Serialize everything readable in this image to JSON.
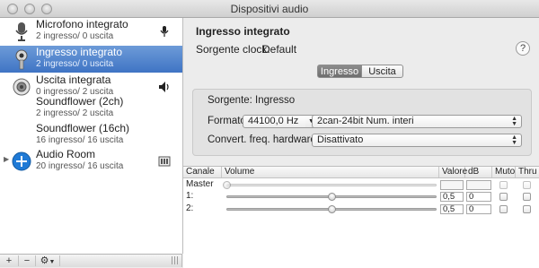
{
  "window": {
    "title": "Dispositivi audio"
  },
  "devices": [
    {
      "name": "Microfono integrato",
      "sub": "2 ingresso/ 0 uscita",
      "icon": "microphone-icon",
      "badge": "microphone-icon",
      "selected": false
    },
    {
      "name": "Ingresso integrato",
      "sub": "2 ingresso/ 0 uscita",
      "icon": "input-jack-icon",
      "badge": "",
      "selected": true
    },
    {
      "name": "Uscita integrata",
      "sub": "0 ingresso/ 2 uscita",
      "icon": "speaker-icon",
      "badge": "volume-icon",
      "selected": false
    },
    {
      "name": "Soundflower (2ch)",
      "sub": "2 ingresso/ 2 uscita",
      "icon": "",
      "badge": "",
      "selected": false
    },
    {
      "name": "Soundflower (16ch)",
      "sub": "16 ingresso/ 16 uscita",
      "icon": "",
      "badge": "",
      "selected": false
    },
    {
      "name": "Audio Room",
      "sub": "20 ingresso/ 16 uscita",
      "icon": "add-device-icon",
      "badge": "aggregate-icon",
      "selected": false
    }
  ],
  "toolbar": {
    "add": "+",
    "remove": "−",
    "gear": "⚙"
  },
  "detail": {
    "title": "Ingresso integrato",
    "clock_label": "Sorgente clock:",
    "clock_value": "Default",
    "tab_input": "Ingresso",
    "tab_output": "Uscita",
    "source_label": "Sorgente:",
    "source_value": "Ingresso",
    "format_label": "Formato:",
    "format_rate": "44100,0 Hz",
    "format_bits": "2can-24bit Num. interi",
    "conv_label": "Convert. freq. hardware:",
    "conv_value": "Disattivato"
  },
  "table": {
    "headers": [
      "Canale",
      "Volume",
      "Valore",
      "dB",
      "Muto",
      "Thru"
    ],
    "rows": [
      {
        "channel": "Master",
        "value": "",
        "db": "",
        "level": null
      },
      {
        "channel": "1:",
        "value": "0,5",
        "db": "0",
        "level": 0.5
      },
      {
        "channel": "2:",
        "value": "0,5",
        "db": "0",
        "level": 0.5
      }
    ]
  }
}
